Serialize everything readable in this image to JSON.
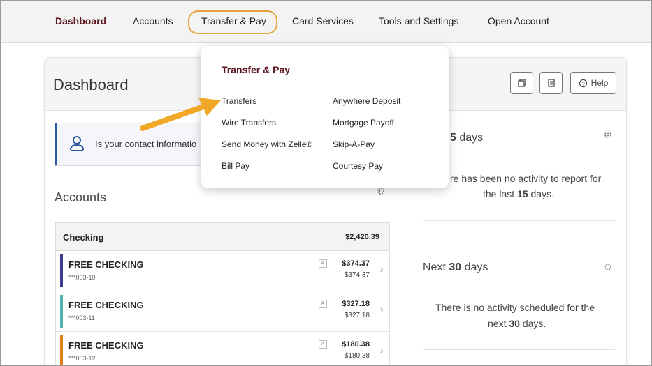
{
  "nav": {
    "items": [
      {
        "label": "Dashboard"
      },
      {
        "label": "Accounts"
      },
      {
        "label": "Transfer & Pay"
      },
      {
        "label": "Card Services"
      },
      {
        "label": "Tools and Settings"
      },
      {
        "label": "Open Account"
      }
    ],
    "active": "Dashboard",
    "highlighted": "Transfer & Pay"
  },
  "dashboard": {
    "title": "Dashboard",
    "help_label": "Help"
  },
  "contact_banner": {
    "text": "Is your contact informatio"
  },
  "accounts": {
    "title": "Accounts",
    "group": {
      "label": "Checking",
      "total": "$2,420.39"
    },
    "rows": [
      {
        "name": "FREE CHECKING",
        "number": "***003-10",
        "badge": "A",
        "available": "$374.37",
        "current": "$374.37",
        "color": "#3a3f8f"
      },
      {
        "name": "FREE CHECKING",
        "number": "***003-11",
        "badge": "A",
        "available": "$327.18",
        "current": "$327.18",
        "color": "#4fb3a9"
      },
      {
        "name": "FREE CHECKING",
        "number": "***003-12",
        "badge": "A",
        "available": "$180.38",
        "current": "$180.38",
        "color": "#e07b1e"
      }
    ]
  },
  "activity": {
    "past_heading_num": "5",
    "past_heading_unit": "days",
    "past_message_1": "re has been no activity to report for",
    "past_message_2_pre": "the last ",
    "past_message_2_num": "15",
    "past_message_2_post": " days.",
    "next_heading_pre": "Next ",
    "next_heading_num": "30",
    "next_heading_unit": " days",
    "next_message_1": "There is no activity scheduled for the",
    "next_message_2_pre": "next ",
    "next_message_2_num": "30",
    "next_message_2_post": " days."
  },
  "dropdown": {
    "title": "Transfer & Pay",
    "left_items": [
      "Transfers",
      "Wire Transfers",
      "Send Money with Zelle®",
      "Bill Pay"
    ],
    "right_items": [
      "Anywhere Deposit",
      "Mortgage Payoff",
      "Skip-A-Pay",
      "Courtesy Pay"
    ]
  },
  "colors": {
    "brand": "#5a1420",
    "highlight": "#e8a33d",
    "arrow": "#f0a826"
  }
}
